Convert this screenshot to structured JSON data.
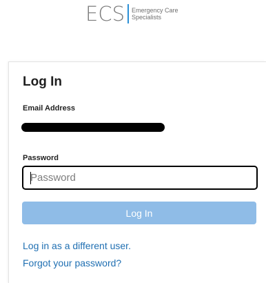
{
  "logo": {
    "mark": "ECS",
    "line1": "Emergency Care",
    "line2": "Specialists",
    "divider_color": "#2a8fd6"
  },
  "form": {
    "title": "Log In",
    "email_label": "Email Address",
    "email_value_redacted": true,
    "password_label": "Password",
    "password_placeholder": "Password",
    "password_value": "",
    "submit_label": "Log In",
    "submit_color": "#8fbce7"
  },
  "links": {
    "different_user": "Log in as a different user.",
    "forgot_password": "Forgot your password?",
    "color": "#1f6fb2"
  }
}
